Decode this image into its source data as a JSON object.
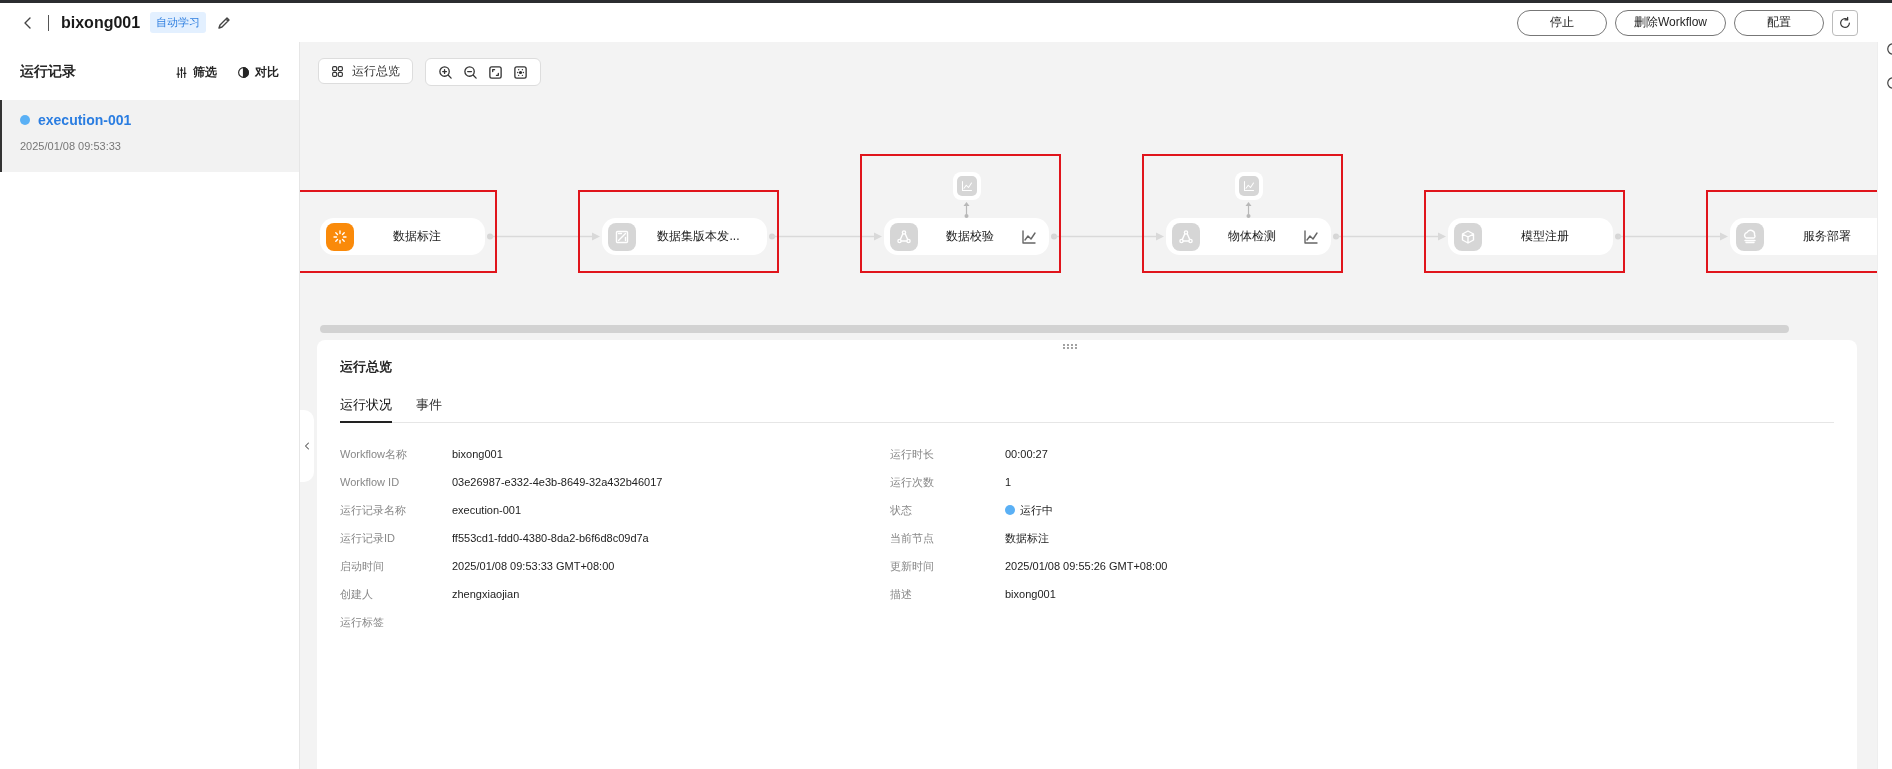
{
  "header": {
    "title": "bixong001",
    "tag": "自动学习",
    "buttons": [
      "停止",
      "删除Workflow",
      "配置"
    ]
  },
  "sidebar": {
    "title": "运行记录",
    "actions": [
      "筛选",
      "对比"
    ],
    "items": [
      {
        "name": "execution-001",
        "time": "2025/01/08 09:53:33",
        "selected": true,
        "color": "#5ab0f5"
      }
    ]
  },
  "toolbar": {
    "overview_button": "运行总览"
  },
  "nodes": [
    {
      "label": "数据标注",
      "running": true,
      "has_metrics": false,
      "highlighted": true
    },
    {
      "label": "数据集版本发...",
      "running": false,
      "has_metrics": false,
      "highlighted": true
    },
    {
      "label": "数据校验",
      "running": false,
      "has_metrics": true,
      "highlighted": true
    },
    {
      "label": "物体检测",
      "running": false,
      "has_metrics": true,
      "highlighted": true
    },
    {
      "label": "模型注册",
      "running": false,
      "has_metrics": false,
      "highlighted": true
    },
    {
      "label": "服务部署",
      "running": false,
      "has_metrics": false,
      "highlighted": true
    }
  ],
  "details": {
    "title": "运行总览",
    "tabs": [
      {
        "label": "运行状况",
        "selected": true
      },
      {
        "label": "事件",
        "selected": false
      }
    ],
    "fields_left": [
      {
        "kind": "text",
        "label": "Workflow名称",
        "value": "bixong001"
      },
      {
        "kind": "text",
        "label": "Workflow ID",
        "value": "03e26987-e332-4e3b-8649-32a432b46017"
      },
      {
        "kind": "text",
        "label": "运行记录名称",
        "value": "execution-001"
      },
      {
        "kind": "text",
        "label": "运行记录ID",
        "value": "ff553cd1-fdd0-4380-8da2-b6f6d8c09d7a"
      },
      {
        "kind": "text",
        "label": "启动时间",
        "value": "2025/01/08 09:53:33 GMT+08:00"
      },
      {
        "kind": "text",
        "label": "创建人",
        "value": "zhengxiaojian"
      },
      {
        "kind": "text",
        "label": "运行标签"
      }
    ],
    "fields_right": [
      {
        "kind": "text",
        "label": "运行时长",
        "value": "00:00:27"
      },
      {
        "kind": "text",
        "label": "运行次数",
        "value": "1"
      },
      {
        "kind": "status",
        "label": "状态",
        "value": "运行中",
        "color": "#5ab0f5"
      },
      {
        "kind": "text",
        "label": "当前节点",
        "value": "数据标注"
      },
      {
        "kind": "text",
        "label": "更新时间",
        "value": "2025/01/08 09:55:26 GMT+08:00"
      },
      {
        "kind": "text",
        "label": "描述",
        "value": "bixong001"
      }
    ]
  }
}
